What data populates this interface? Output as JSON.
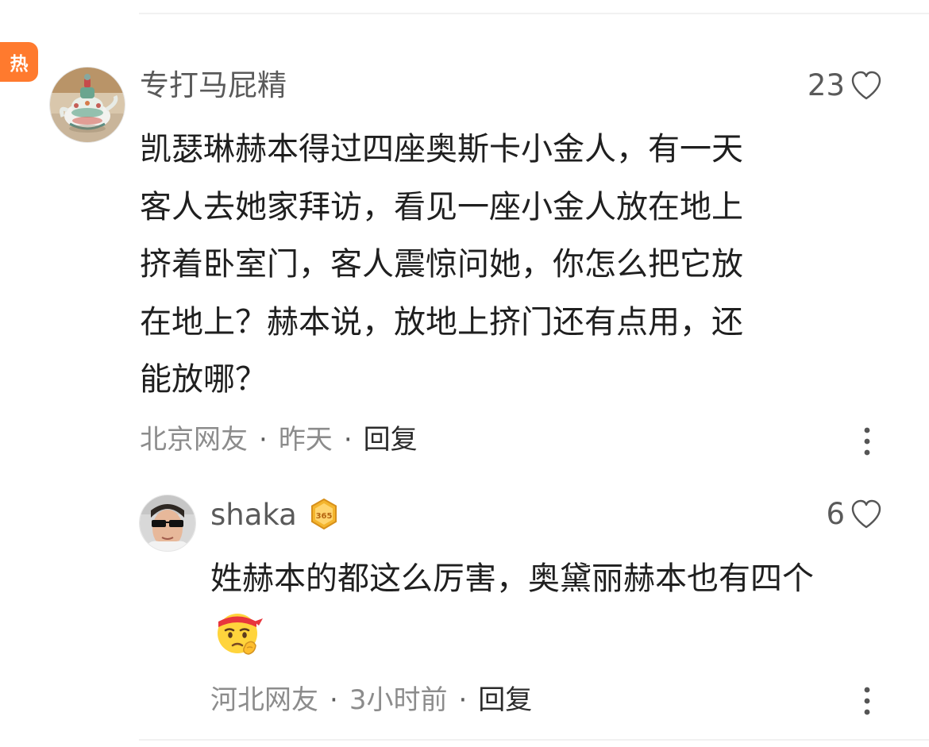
{
  "comments": [
    {
      "hot_label": "热",
      "username": "专打马屁精",
      "likes": "23",
      "text_lines": [
        "凯瑟琳赫本得过四座奥斯卡小金人，有一天",
        "客人去她家拜访，看见一座小金人放在地上",
        "挤着卧室门，客人震惊问她，你怎么把它放",
        "在地上？赫本说，放地上挤门还有点用，还",
        "能放哪？"
      ],
      "location": "北京网友",
      "time": "昨天",
      "reply_label": "回复",
      "avatar": "teapot-avatar",
      "separator": "·"
    },
    {
      "username": "shaka",
      "badge_text": "365",
      "likes": "6",
      "text_lines": [
        "姓赫本的都这么厉害，奥黛丽赫本也有四个"
      ],
      "emoji": "thinking-face-headband-emoji",
      "location": "河北网友",
      "time": "3小时前",
      "reply_label": "回复",
      "avatar": "sunglasses-person-avatar",
      "separator": "·"
    }
  ],
  "colors": {
    "hot_badge": "#ff7a2e",
    "username": "#5a5a5a",
    "body_text": "#1f1f1f",
    "meta_gray": "#8c8c8c",
    "reply_text": "#2b2b2b",
    "divider": "#f1f1f1",
    "level_badge": "#f4b52e"
  },
  "icons": {
    "like": "heart-outline-icon",
    "more": "vertical-ellipsis-icon",
    "level": "level-365-badge-icon"
  }
}
